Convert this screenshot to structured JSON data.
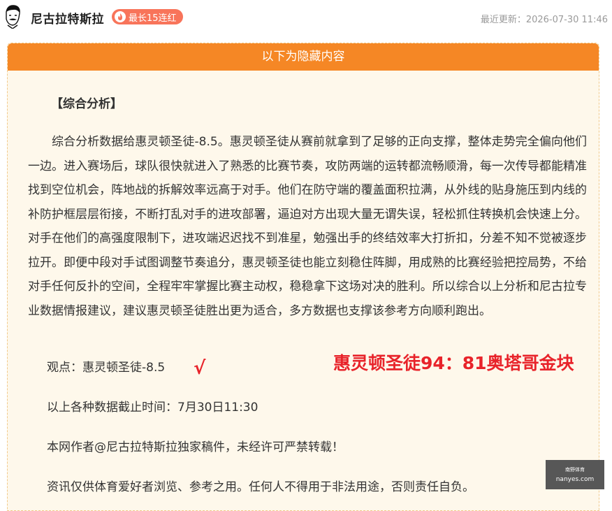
{
  "header": {
    "author_name": "尼古拉特斯拉",
    "badge_label": "最长15连红",
    "last_updated": "最近更新：2026-07-30 11:46"
  },
  "panel": {
    "title": "以下为隐藏内容",
    "section_heading": "【综合分析】",
    "body": "综合分析数据给惠灵顿圣徒-8.5。惠灵顿圣徒从赛前就拿到了足够的正向支撑，整体走势完全偏向他们一边。进入赛场后，球队很快就进入了熟悉的比赛节奏，攻防两端的运转都流畅顺滑，每一次传导都能精准找到空位机会，阵地战的拆解效率远高于对手。他们在防守端的覆盖面积拉满，从外线的贴身施压到内线的补防护框层层衔接，不断打乱对手的进攻部署，逼迫对方出现大量无谓失误，轻松抓住转换机会快速上分。对手在他们的高强度限制下，进攻端迟迟找不到准星，勉强出手的终结效率大打折扣，分差不知不觉被逐步拉开。即便中段对手试图调整节奏追分，惠灵顿圣徒也能立刻稳住阵脚，用成熟的比赛经验把控局势，不给对手任何反扑的空间，全程牢牢掌握比赛主动权，稳稳拿下这场对决的胜利。所以综合以上分析和尼古拉专业数据情报建议，建议惠灵顿圣徒胜出更为适合，多方数据也支撑该参考方向顺利跑出。",
    "viewpoint": "观点：惠灵顿圣徒-8.5",
    "check_mark": "√",
    "result": "惠灵顿圣徒94：81奥塔哥金块",
    "cutoff": "以上各种数据截止时间：7月30日11:30",
    "copyright": "本网作者@尼古拉特斯拉独家稿件，未经许可严禁转载！",
    "disclaimer": "资讯仅供体育爱好者浏览、参考之用。任何人不得用于非法用途，否则责任自负。"
  },
  "watermark": {
    "top": "南野体育",
    "bottom": "nanyes.com"
  },
  "colors": {
    "accent": "#f58725",
    "badge": "#f8745a",
    "result_red": "#e8232a",
    "panel_bg": "#fef8eb"
  }
}
